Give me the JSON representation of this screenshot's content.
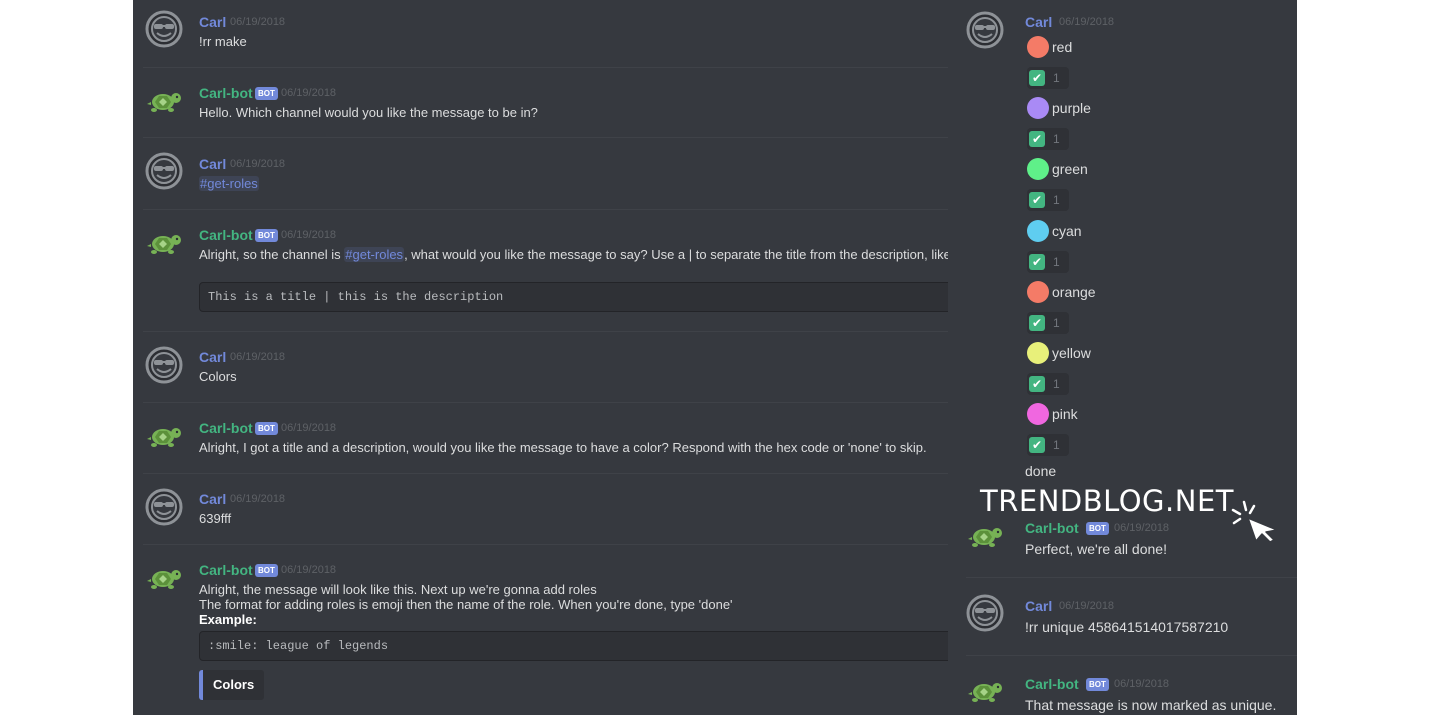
{
  "left_messages": [
    {
      "author": "Carl",
      "bot": false,
      "timestamp": "06/19/2018",
      "lines": [
        "!rr make"
      ]
    },
    {
      "author": "Carl-bot",
      "bot": true,
      "badge": "BOT",
      "timestamp": "06/19/2018",
      "lines": [
        "Hello. Which channel would you like the message to be in?"
      ]
    },
    {
      "author": "Carl",
      "bot": false,
      "timestamp": "06/19/2018",
      "mention": "#get-roles"
    },
    {
      "author": "Carl-bot",
      "bot": true,
      "badge": "BOT",
      "timestamp": "06/19/2018",
      "text_before": "Alright, so the channel is ",
      "mention": "#get-roles",
      "text_after": ", what would you like the message to say? Use a | to separate the title from the description, like so",
      "code": "This is a title | this is the description"
    },
    {
      "author": "Carl",
      "bot": false,
      "timestamp": "06/19/2018",
      "lines": [
        "Colors"
      ]
    },
    {
      "author": "Carl-bot",
      "bot": true,
      "badge": "BOT",
      "timestamp": "06/19/2018",
      "lines": [
        "Alright, I got a title and a description, would you like the message to have a color? Respond with the hex code or 'none' to skip."
      ]
    },
    {
      "author": "Carl",
      "bot": false,
      "timestamp": "06/19/2018",
      "lines": [
        "639fff"
      ]
    },
    {
      "author": "Carl-bot",
      "bot": true,
      "badge": "BOT",
      "timestamp": "06/19/2018",
      "lines": [
        "Alright, the message will look like this. Next up we're gonna add roles",
        "The format for adding roles is emoji then the name of the role. When you're done, type 'done'"
      ],
      "bold_line": "Example:",
      "code": ":smile: league of legends",
      "embed_title": "Colors"
    }
  ],
  "right_top": {
    "author": "Carl",
    "timestamp": "06/19/2018",
    "roles": [
      {
        "name": "red",
        "color": "#f47b67",
        "count": "1"
      },
      {
        "name": "purple",
        "color": "#a98af5",
        "count": "1"
      },
      {
        "name": "green",
        "color": "#5ff089",
        "count": "1"
      },
      {
        "name": "cyan",
        "color": "#5fcdf0",
        "count": "1"
      },
      {
        "name": "orange",
        "color": "#f47b67",
        "count": "1"
      },
      {
        "name": "yellow",
        "color": "#e8f07a",
        "count": "1"
      },
      {
        "name": "pink",
        "color": "#f067e0",
        "count": "1"
      }
    ],
    "done_text": "done"
  },
  "right_messages": [
    {
      "author": "Carl-bot",
      "bot": true,
      "badge": "BOT",
      "timestamp": "06/19/2018",
      "text": "Perfect, we're all done!"
    },
    {
      "author": "Carl",
      "bot": false,
      "timestamp": "06/19/2018",
      "text": "!rr unique 458641514017587210"
    },
    {
      "author": "Carl-bot",
      "bot": true,
      "badge": "BOT",
      "timestamp": "06/19/2018",
      "text": "That message is now marked as unique."
    }
  ],
  "watermark": "TRENDBLOG.NET",
  "colors": {
    "background": "#36393f",
    "carl_name": "#7289da",
    "bot_name": "#43b581",
    "check": "#43b581"
  },
  "icons": {
    "user_avatar": "sunglasses-face-icon",
    "bot_avatar": "turtle-icon",
    "reaction": "check-mark-icon",
    "watermark_cursor": "cursor-click-icon"
  }
}
